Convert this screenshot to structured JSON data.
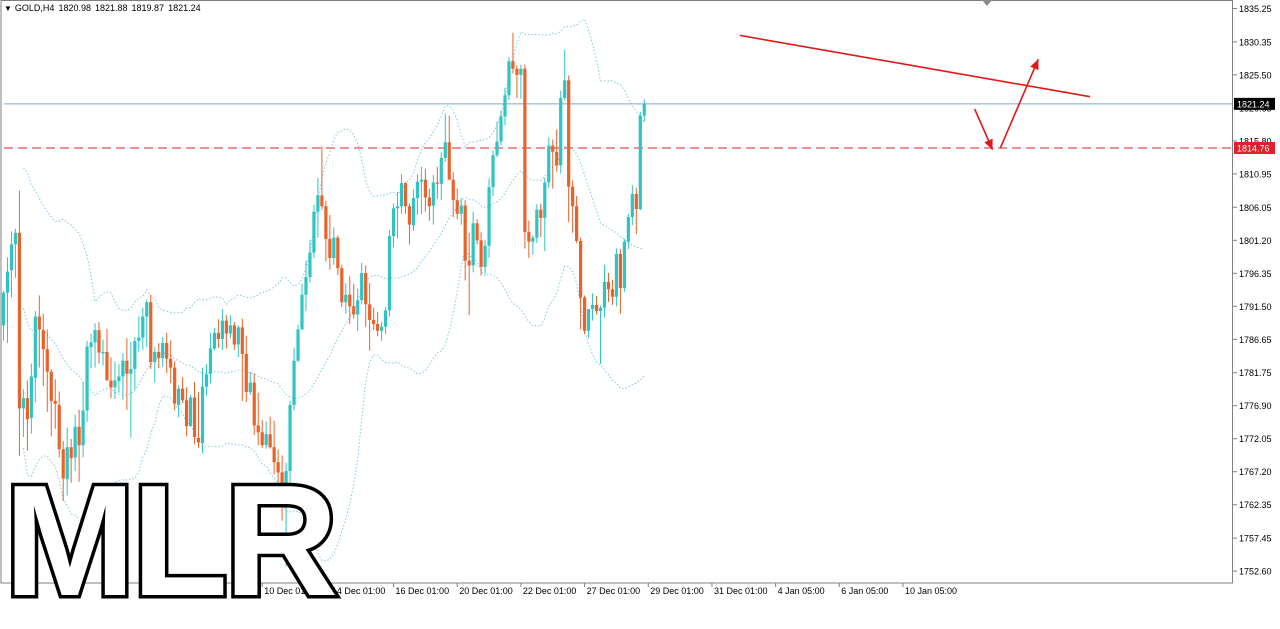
{
  "header": {
    "symbol": "GOLD,H4",
    "open": "1820.98",
    "high": "1821.88",
    "low": "1819.87",
    "close": "1821.24"
  },
  "watermark": "MLR",
  "chart_data": {
    "type": "candlestick",
    "symbol": "GOLD",
    "timeframe": "H4",
    "ylim": [
      1751.0,
      1836.5
    ],
    "y_ticks": [
      "1835.25",
      "1830.35",
      "1825.50",
      "1820.65",
      "1815.80",
      "1810.95",
      "1806.05",
      "1801.20",
      "1796.35",
      "1791.50",
      "1786.65",
      "1781.75",
      "1776.90",
      "1772.05",
      "1767.20",
      "1762.35",
      "1757.45",
      "1752.60"
    ],
    "x_ticks": [
      "10 Dec 01:00",
      "14 Dec 01:00",
      "16 Dec 01:00",
      "20 Dec 01:00",
      "22 Dec 01:00",
      "27 Dec 01:00",
      "29 Dec 01:00",
      "31 Dec 01:00",
      "4 Jan 05:00",
      "6 Jan 05:00",
      "10 Jan 05:00"
    ],
    "x_tick_index": [
      65,
      82,
      98,
      114,
      130,
      146,
      162,
      178,
      194,
      210,
      226
    ],
    "current_price": "1821.24",
    "level_price": "1814.76",
    "trendline": {
      "from_index": 185,
      "from_price": 1831.3,
      "to_index": 273,
      "to_price": 1822.3
    },
    "arrows": [
      {
        "from_index": 244,
        "from_price": 1820.5,
        "to_index": 248.5,
        "to_price": 1814.5
      },
      {
        "from_index": 250.5,
        "from_price": 1814.8,
        "to_index": 260,
        "to_price": 1827.8
      }
    ],
    "colors": {
      "bull": "#2ec4c4",
      "bear": "#e8622a",
      "bands": "#7ec8e3",
      "level": "#e05050",
      "trendline": "#e01818",
      "price_line": "#7fa8c8",
      "price_tag_bg": "#000000",
      "level_tag_bg": "#e0202a"
    },
    "candles": [
      [
        1788.7,
        1793.8,
        1786.5,
        1793.5
      ],
      [
        1793.5,
        1798.7,
        1786.1,
        1796.6
      ],
      [
        1796.8,
        1802.5,
        1792.8,
        1800.6
      ],
      [
        1800.6,
        1802.9,
        1795.7,
        1802.3
      ],
      [
        1802.3,
        1808.5,
        1769.5,
        1776.5
      ],
      [
        1776.5,
        1779.3,
        1772.3,
        1778.0
      ],
      [
        1778.0,
        1780.6,
        1770.3,
        1774.9
      ],
      [
        1775.1,
        1783.1,
        1772.8,
        1781.2
      ],
      [
        1781.0,
        1790.8,
        1777.4,
        1790.0
      ],
      [
        1790.0,
        1793.1,
        1782.5,
        1788.1
      ],
      [
        1788.0,
        1790.4,
        1779.8,
        1785.2
      ],
      [
        1785.2,
        1788.1,
        1776.0,
        1781.9
      ],
      [
        1781.9,
        1782.3,
        1772.4,
        1777.6
      ],
      [
        1777.6,
        1780.8,
        1773.5,
        1777.2
      ],
      [
        1777.0,
        1779.0,
        1769.3,
        1770.5
      ],
      [
        1770.5,
        1771.7,
        1762.9,
        1766.2
      ],
      [
        1766.1,
        1773.7,
        1763.7,
        1770.8
      ],
      [
        1770.8,
        1772.0,
        1765.6,
        1769.2
      ],
      [
        1769.3,
        1775.6,
        1767.3,
        1773.8
      ],
      [
        1773.8,
        1776.3,
        1765.7,
        1771.1
      ],
      [
        1771.1,
        1780.3,
        1769.3,
        1776.2
      ],
      [
        1776.2,
        1786.4,
        1774.5,
        1785.6
      ],
      [
        1785.5,
        1787.5,
        1782.4,
        1786.2
      ],
      [
        1786.2,
        1789.0,
        1782.5,
        1788.0
      ],
      [
        1788.0,
        1789.2,
        1783.1,
        1784.7
      ],
      [
        1784.6,
        1786.6,
        1782.8,
        1784.8
      ],
      [
        1784.8,
        1788.2,
        1781.2,
        1780.6
      ],
      [
        1780.6,
        1784.0,
        1778.0,
        1779.6
      ],
      [
        1779.6,
        1783.4,
        1777.9,
        1780.6
      ],
      [
        1780.5,
        1783.0,
        1778.8,
        1781.2
      ],
      [
        1781.2,
        1784.6,
        1777.8,
        1783.5
      ],
      [
        1783.5,
        1786.8,
        1776.3,
        1781.6
      ],
      [
        1781.6,
        1786.3,
        1772.2,
        1782.3
      ],
      [
        1782.3,
        1787.0,
        1779.3,
        1786.4
      ],
      [
        1786.4,
        1790.0,
        1784.8,
        1786.9
      ],
      [
        1786.9,
        1791.3,
        1785.1,
        1790.0
      ],
      [
        1790.0,
        1792.5,
        1785.5,
        1792.1
      ],
      [
        1792.1,
        1793.2,
        1782.3,
        1783.3
      ],
      [
        1783.3,
        1785.5,
        1780.3,
        1784.8
      ],
      [
        1784.8,
        1786.1,
        1782.4,
        1783.9
      ],
      [
        1783.9,
        1787.0,
        1782.6,
        1786.1
      ],
      [
        1786.1,
        1787.6,
        1781.7,
        1783.8
      ],
      [
        1783.8,
        1786.5,
        1780.2,
        1782.5
      ],
      [
        1782.5,
        1783.4,
        1776.2,
        1777.2
      ],
      [
        1777.0,
        1779.9,
        1775.2,
        1779.4
      ],
      [
        1779.4,
        1781.1,
        1777.3,
        1777.7
      ],
      [
        1777.7,
        1779.6,
        1772.4,
        1773.9
      ],
      [
        1773.9,
        1778.5,
        1773.8,
        1778.1
      ],
      [
        1778.1,
        1780.4,
        1771.2,
        1772.3
      ],
      [
        1772.2,
        1778.9,
        1770.7,
        1771.5
      ],
      [
        1771.4,
        1782.5,
        1769.9,
        1779.7
      ],
      [
        1779.7,
        1783.0,
        1778.4,
        1781.5
      ],
      [
        1781.6,
        1787.6,
        1780.2,
        1785.3
      ],
      [
        1785.3,
        1788.3,
        1785.0,
        1787.6
      ],
      [
        1787.6,
        1789.6,
        1785.4,
        1786.7
      ],
      [
        1786.7,
        1791.1,
        1785.1,
        1789.4
      ],
      [
        1789.4,
        1790.2,
        1785.3,
        1787.5
      ],
      [
        1787.5,
        1790.2,
        1786.8,
        1788.7
      ],
      [
        1788.7,
        1789.2,
        1785.1,
        1785.9
      ],
      [
        1785.9,
        1788.7,
        1784.0,
        1788.4
      ],
      [
        1788.4,
        1789.7,
        1777.6,
        1784.5
      ],
      [
        1784.5,
        1787.2,
        1777.4,
        1778.9
      ],
      [
        1778.9,
        1781.9,
        1778.5,
        1780.3
      ],
      [
        1780.3,
        1781.6,
        1772.6,
        1774.0
      ],
      [
        1774.0,
        1778.8,
        1771.1,
        1773.0
      ],
      [
        1773.0,
        1774.8,
        1770.7,
        1771.1
      ],
      [
        1771.1,
        1774.6,
        1770.6,
        1772.7
      ],
      [
        1772.7,
        1775.3,
        1770.6,
        1770.8
      ],
      [
        1770.8,
        1774.7,
        1766.8,
        1768.6
      ],
      [
        1768.6,
        1770.5,
        1763.0,
        1767.1
      ],
      [
        1767.1,
        1769.6,
        1760.0,
        1763.5
      ],
      [
        1763.5,
        1768.5,
        1753.3,
        1767.3
      ],
      [
        1767.3,
        1777.6,
        1765.5,
        1777.0
      ],
      [
        1777.0,
        1785.4,
        1776.2,
        1783.5
      ],
      [
        1783.5,
        1788.8,
        1783.3,
        1788.1
      ],
      [
        1788.1,
        1794.8,
        1788.1,
        1793.2
      ],
      [
        1793.2,
        1798.2,
        1790.8,
        1795.8
      ],
      [
        1795.8,
        1801.3,
        1795.0,
        1799.4
      ],
      [
        1799.4,
        1806.4,
        1798.6,
        1805.4
      ],
      [
        1805.4,
        1810.4,
        1801.6,
        1807.8
      ],
      [
        1807.8,
        1815.0,
        1805.7,
        1806.2
      ],
      [
        1806.2,
        1807.0,
        1798.1,
        1801.4
      ],
      [
        1801.4,
        1804.9,
        1796.9,
        1798.6
      ],
      [
        1798.6,
        1803.1,
        1797.6,
        1801.6
      ],
      [
        1801.6,
        1801.9,
        1796.1,
        1797.1
      ],
      [
        1797.1,
        1797.6,
        1791.4,
        1792.1
      ],
      [
        1792.1,
        1794.9,
        1790.4,
        1793.2
      ],
      [
        1793.2,
        1795.9,
        1788.9,
        1791.5
      ],
      [
        1791.5,
        1794.8,
        1789.7,
        1790.3
      ],
      [
        1790.3,
        1794.1,
        1787.9,
        1792.4
      ],
      [
        1792.4,
        1797.9,
        1791.8,
        1796.4
      ],
      [
        1796.4,
        1797.5,
        1788.5,
        1791.8
      ],
      [
        1791.8,
        1794.9,
        1785.0,
        1789.5
      ],
      [
        1789.5,
        1791.3,
        1788.0,
        1788.9
      ],
      [
        1788.9,
        1790.7,
        1787.1,
        1787.9
      ],
      [
        1787.9,
        1789.2,
        1786.4,
        1788.5
      ],
      [
        1788.5,
        1791.4,
        1787.4,
        1790.9
      ],
      [
        1790.9,
        1802.7,
        1790.0,
        1801.8
      ],
      [
        1801.8,
        1806.6,
        1800.2,
        1805.9
      ],
      [
        1805.9,
        1808.3,
        1801.5,
        1806.2
      ],
      [
        1806.2,
        1810.9,
        1805.1,
        1809.6
      ],
      [
        1809.6,
        1809.7,
        1805.1,
        1806.2
      ],
      [
        1806.2,
        1806.6,
        1800.6,
        1803.5
      ],
      [
        1803.4,
        1808.7,
        1802.6,
        1807.4
      ],
      [
        1807.4,
        1810.9,
        1804.9,
        1809.8
      ],
      [
        1809.8,
        1812.0,
        1805.0,
        1810.1
      ],
      [
        1810.1,
        1811.7,
        1805.4,
        1807.5
      ],
      [
        1807.5,
        1808.8,
        1804.1,
        1806.2
      ],
      [
        1806.3,
        1810.8,
        1803.5,
        1809.7
      ],
      [
        1809.7,
        1812.0,
        1807.3,
        1809.5
      ],
      [
        1809.5,
        1814.1,
        1807.1,
        1813.3
      ],
      [
        1813.3,
        1819.8,
        1812.7,
        1815.6
      ],
      [
        1815.6,
        1819.5,
        1812.5,
        1810.1
      ],
      [
        1810.1,
        1811.2,
        1804.6,
        1807.1
      ],
      [
        1807.1,
        1808.8,
        1804.3,
        1805.1
      ],
      [
        1805.1,
        1807.4,
        1803.5,
        1806.3
      ],
      [
        1806.3,
        1807.1,
        1795.3,
        1798.2
      ],
      [
        1798.2,
        1802.3,
        1790.2,
        1797.5
      ],
      [
        1797.5,
        1805.4,
        1796.5,
        1803.7
      ],
      [
        1803.7,
        1804.3,
        1800.6,
        1801.2
      ],
      [
        1801.2,
        1802.4,
        1796.0,
        1797.3
      ],
      [
        1797.3,
        1801.3,
        1796.2,
        1800.4
      ],
      [
        1800.4,
        1810.3,
        1798.6,
        1809.0
      ],
      [
        1809.0,
        1814.4,
        1807.7,
        1813.7
      ],
      [
        1813.7,
        1818.6,
        1813.4,
        1815.7
      ],
      [
        1815.7,
        1820.3,
        1815.1,
        1819.4
      ],
      [
        1819.4,
        1823.6,
        1818.1,
        1822.5
      ],
      [
        1822.5,
        1828.1,
        1821.8,
        1827.5
      ],
      [
        1827.5,
        1831.7,
        1825.7,
        1826.4
      ],
      [
        1826.4,
        1826.9,
        1822.1,
        1825.5
      ],
      [
        1825.5,
        1827.0,
        1822.0,
        1826.4
      ],
      [
        1826.4,
        1827.0,
        1800.0,
        1802.4
      ],
      [
        1802.4,
        1804.1,
        1798.6,
        1801.0
      ],
      [
        1801.0,
        1801.9,
        1799.1,
        1801.6
      ],
      [
        1801.6,
        1806.5,
        1800.8,
        1805.7
      ],
      [
        1805.7,
        1806.6,
        1801.7,
        1804.5
      ],
      [
        1804.5,
        1810.4,
        1799.6,
        1809.7
      ],
      [
        1809.7,
        1816.3,
        1808.9,
        1815.1
      ],
      [
        1815.1,
        1816.0,
        1808.8,
        1814.2
      ],
      [
        1814.2,
        1817.5,
        1811.3,
        1812.2
      ],
      [
        1812.2,
        1823.2,
        1811.0,
        1822.1
      ],
      [
        1822.1,
        1829.2,
        1821.8,
        1824.7
      ],
      [
        1824.7,
        1825.4,
        1803.9,
        1809.1
      ],
      [
        1809.1,
        1810.0,
        1802.3,
        1806.2
      ],
      [
        1806.2,
        1807.7,
        1800.8,
        1801.1
      ],
      [
        1801.1,
        1801.6,
        1788.1,
        1792.8
      ],
      [
        1792.8,
        1793.1,
        1787.4,
        1787.9
      ],
      [
        1787.9,
        1791.0,
        1786.8,
        1791.1
      ],
      [
        1791.1,
        1793.4,
        1789.4,
        1791.7
      ],
      [
        1791.7,
        1793.0,
        1790.3,
        1790.8
      ],
      [
        1790.8,
        1791.6,
        1783.0,
        1791.3
      ],
      [
        1791.3,
        1797.6,
        1789.9,
        1795.1
      ],
      [
        1795.1,
        1796.4,
        1792.1,
        1794.0
      ],
      [
        1794.0,
        1795.4,
        1791.7,
        1792.9
      ],
      [
        1792.9,
        1800.0,
        1791.5,
        1799.2
      ],
      [
        1799.2,
        1799.9,
        1790.4,
        1794.2
      ],
      [
        1794.2,
        1801.4,
        1793.6,
        1801.0
      ],
      [
        1801.0,
        1805.1,
        1799.9,
        1804.6
      ],
      [
        1804.6,
        1809.3,
        1803.4,
        1808.0
      ],
      [
        1808.0,
        1808.9,
        1802.1,
        1805.8
      ],
      [
        1805.8,
        1820.1,
        1805.6,
        1819.5
      ],
      [
        1819.5,
        1821.9,
        1818.6,
        1821.2
      ]
    ]
  }
}
